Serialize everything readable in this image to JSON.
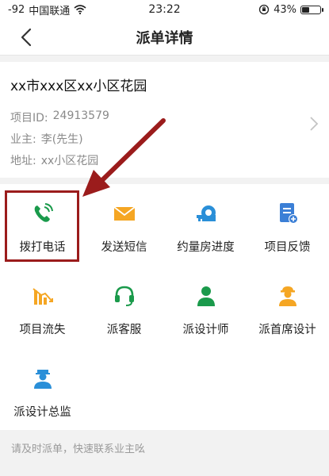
{
  "status_bar": {
    "signal": "-92",
    "carrier": "中国联通",
    "time": "23:22",
    "battery": "43%",
    "battery_level": 0.43
  },
  "nav": {
    "title": "派单详情"
  },
  "info": {
    "address": "xx市xxx区xx小区花园",
    "project_id_label": "项目ID:",
    "project_id_value": "24913579",
    "owner_label": "业主:",
    "owner_value": "李(先生)",
    "addr_label": "地址:",
    "addr_value": "xx小区花园"
  },
  "actions": [
    {
      "label": "拨打电话",
      "icon": "phone-icon",
      "color": "#1a9a4b"
    },
    {
      "label": "发送短信",
      "icon": "envelope-icon",
      "color": "#f5a623"
    },
    {
      "label": "约量房进度",
      "icon": "tape-measure-icon",
      "color": "#2a8fd8"
    },
    {
      "label": "项目反馈",
      "icon": "document-add-icon",
      "color": "#3b7fd6"
    },
    {
      "label": "项目流失",
      "icon": "bar-chart-icon",
      "color": "#f5a623"
    },
    {
      "label": "派客服",
      "icon": "headset-icon",
      "color": "#1a9a4b"
    },
    {
      "label": "派设计师",
      "icon": "person-icon",
      "color": "#1a9a4b"
    },
    {
      "label": "派首席设计",
      "icon": "worker-icon",
      "color": "#f5a623"
    },
    {
      "label": "派设计总监",
      "icon": "supervisor-icon",
      "color": "#2a8fd8"
    }
  ],
  "footer": {
    "note": "请及时派单，快速联系业主吆"
  },
  "colors": {
    "highlight": "#9b1c1c"
  }
}
